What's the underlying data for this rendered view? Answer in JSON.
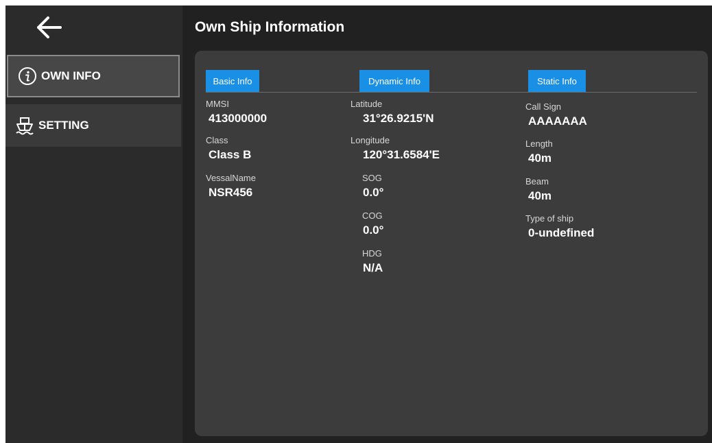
{
  "header": {
    "title": "Own Ship Information"
  },
  "sidebar": {
    "back_icon": "arrow-left-icon",
    "items": [
      {
        "label": "OWN INFO",
        "icon": "info-circle-icon",
        "selected": true
      },
      {
        "label": "SETTING",
        "icon": "ship-icon",
        "selected": false
      }
    ]
  },
  "columns": {
    "basic": {
      "header": "Basic Info",
      "fields": [
        {
          "label": "MMSI",
          "value": "413000000"
        },
        {
          "label": "Class",
          "value": "Class B"
        },
        {
          "label": "VessalName",
          "value": "NSR456"
        }
      ]
    },
    "dynamic": {
      "header": "Dynamic Info",
      "fields": [
        {
          "label": "Latitude",
          "value": "31°26.9215'N"
        },
        {
          "label": "Longitude",
          "value": "120°31.6584'E"
        },
        {
          "label": "SOG",
          "value": "0.0°"
        },
        {
          "label": "COG",
          "value": "0.0°"
        },
        {
          "label": "HDG",
          "value": "N/A"
        }
      ]
    },
    "static": {
      "header": "Static Info",
      "fields": [
        {
          "label": "Call Sign",
          "value": "AAAAAAA"
        },
        {
          "label": "Length",
          "value": "40m"
        },
        {
          "label": "Beam",
          "value": "40m"
        },
        {
          "label": "Type of ship",
          "value": "0-undefined"
        }
      ]
    }
  },
  "colors": {
    "accent": "#1a8fe6",
    "background": "#212121",
    "panel": "#3c3c3c",
    "sidebar": "#2b2b2b"
  }
}
